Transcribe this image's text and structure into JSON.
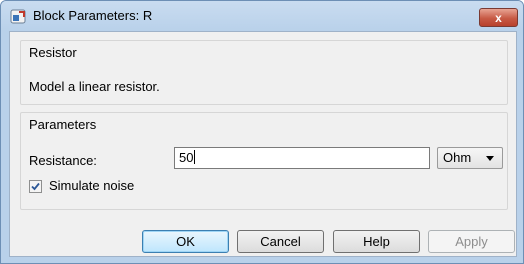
{
  "window": {
    "title": "Block Parameters: R",
    "close_label": "x"
  },
  "resistor_group": {
    "title": "Resistor",
    "description": "Model a linear resistor."
  },
  "parameters_group": {
    "title": "Parameters",
    "resistance_label": "Resistance:",
    "resistance_value": "50",
    "unit_value": "Ohm",
    "simulate_noise_label": "Simulate noise",
    "simulate_noise_checked": true
  },
  "buttons": {
    "ok": "OK",
    "cancel": "Cancel",
    "help": "Help",
    "apply": "Apply"
  },
  "colors": {
    "frame": "#b9d1ea",
    "close": "#c75a45",
    "ok_accent": "#3c7fb1",
    "disabled_text": "#8d8d8d"
  },
  "icons": {
    "app": "simulink-block-icon",
    "close": "close-icon",
    "dropdown": "chevron-down-icon",
    "check": "checkmark-icon"
  }
}
